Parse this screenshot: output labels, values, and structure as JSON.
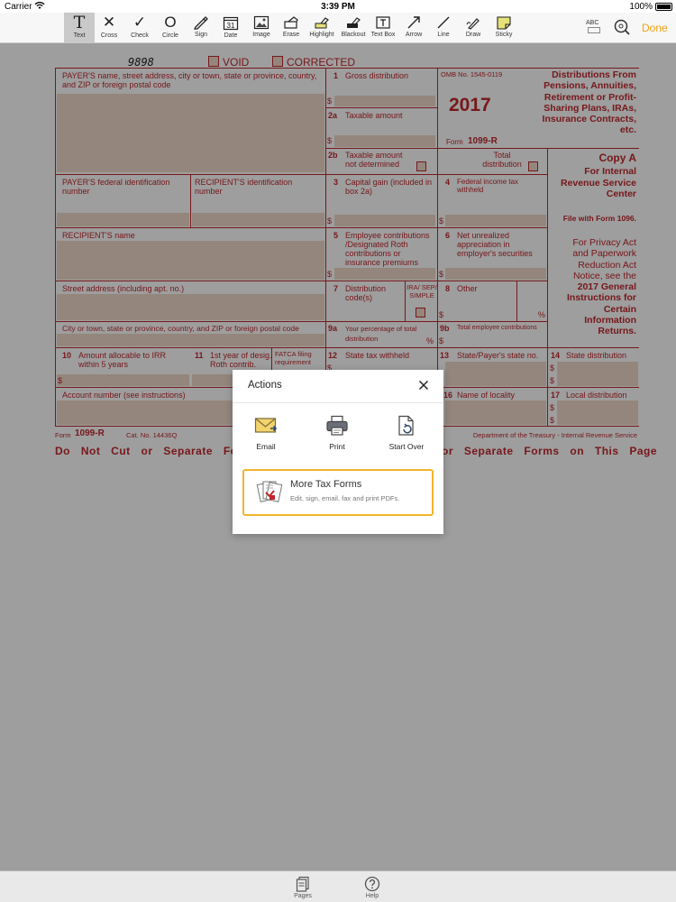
{
  "status_bar": {
    "carrier": "Carrier",
    "time": "3:39 PM",
    "battery": "100%"
  },
  "toolbar": {
    "tools": [
      {
        "label": "Text",
        "glyph": "T"
      },
      {
        "label": "Cross",
        "glyph": "✕"
      },
      {
        "label": "Check",
        "glyph": "✓"
      },
      {
        "label": "Circle",
        "glyph": "O"
      },
      {
        "label": "Sign"
      },
      {
        "label": "Date",
        "glyph": "31"
      },
      {
        "label": "Image"
      },
      {
        "label": "Erase"
      },
      {
        "label": "Highlight"
      },
      {
        "label": "Blackout"
      },
      {
        "label": "Text Box"
      },
      {
        "label": "Arrow"
      },
      {
        "label": "Line"
      },
      {
        "label": "Draw"
      },
      {
        "label": "Sticky"
      }
    ],
    "active_tool": "Text",
    "abc_label": "ABC",
    "done_label": "Done"
  },
  "form": {
    "handwritten": "9898",
    "void": "VOID",
    "corrected": "CORRECTED",
    "payer_name": "PAYER'S name, street address, city or town, state or province, country, and ZIP or foreign postal code",
    "box1_num": "1",
    "box1": "Gross distribution",
    "omb": "OMB No. 1545-0119",
    "year": "2017",
    "box2a_num": "2a",
    "box2a": "Taxable amount",
    "form_id_label": "Form",
    "form_id": "1099-R",
    "title": "Distributions From Pensions, Annuities, Retirement or Profit-Sharing Plans, IRAs, Insurance Contracts, etc.",
    "box2b_num": "2b",
    "box2b": "Taxable amount not determined",
    "total_dist": "Total distribution",
    "copy": "Copy A",
    "for_irs": "For Internal Revenue Service Center",
    "payer_fed": "PAYER'S federal identification number",
    "recipient_id": "RECIPIENT'S identification number",
    "box3_num": "3",
    "box3": "Capital gain (included in box 2a)",
    "box4_num": "4",
    "box4": "Federal income tax withheld",
    "file_with": "File with Form 1096.",
    "recipient_name": "RECIPIENT'S name",
    "box5_num": "5",
    "box5": "Employee contributions /Designated Roth contributions or insurance premiums",
    "box6_num": "6",
    "box6": "Net unrealized appreciation in employer's securities",
    "privacy": "For Privacy Act and Paperwork Reduction Act Notice, see the",
    "privacy_bold": "2017 General Instructions for Certain Information Returns.",
    "street": "Street address (including apt. no.)",
    "box7_num": "7",
    "box7": "Distribution code(s)",
    "ira": "IRA/ SEP/ SIMPLE",
    "box8_num": "8",
    "box8": "Other",
    "city": "City or town, state or province, country, and ZIP or foreign postal code",
    "box9a_num": "9a",
    "box9a": "Your percentage of total distribution",
    "box9b_num": "9b",
    "box9b": "Total employee contributions",
    "box10_num": "10",
    "box10": "Amount allocable to IRR within 5 years",
    "box11_num": "11",
    "box11": "1st year of desig. Roth contrib.",
    "fatca": "FATCA filing requirement",
    "box12_num": "12",
    "box12": "State tax withheld",
    "box13_num": "13",
    "box13": "State/Payer's state no.",
    "box14_num": "14",
    "box14": "State distribution",
    "account": "Account number (see instructions)",
    "box16_num": "16",
    "box16": "Name of locality",
    "box17_num": "17",
    "box17": "Local distribution",
    "footer_form_label": "Form",
    "footer_form": "1099-R",
    "cat": "Cat. No. 14436Q",
    "dept": "Department of the Treasury - Internal Revenue Service",
    "cut_left": "Do Not Cut or Separate Form",
    "cut_right": "or Separate Forms on This Page",
    "dollar": "$",
    "percent": "%"
  },
  "modal": {
    "title": "Actions",
    "actions": [
      {
        "label": "Email",
        "icon": "envelope-icon"
      },
      {
        "label": "Print",
        "icon": "printer-icon"
      },
      {
        "label": "Start Over",
        "icon": "document-refresh-icon"
      }
    ],
    "promo_title": "More Tax Forms",
    "promo_subtitle": "Edit, sign, email, fax and print PDFs."
  },
  "bottom_bar": {
    "pages": "Pages",
    "help": "Help"
  },
  "colors": {
    "form_red": "#c0272d",
    "accent": "#f2a011",
    "promo_border": "#f2b52b",
    "field_fill": "#efd9c8"
  }
}
